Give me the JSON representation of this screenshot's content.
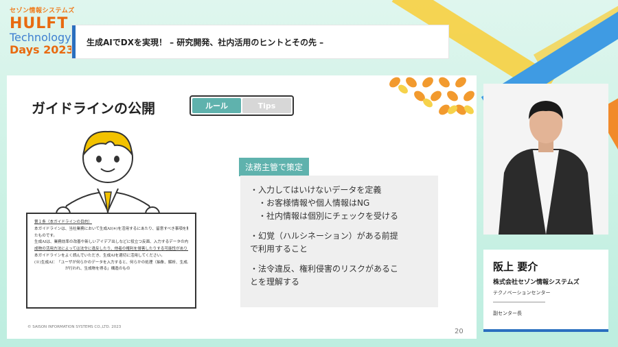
{
  "logo": {
    "brand": "セゾン情報システムズ",
    "line1": "HULFT",
    "line2": "Technology",
    "line3": "Days 2023"
  },
  "header": {
    "title": "生成AIでDXを実現！ – 研究開発、社内活用のヒントとその先 –"
  },
  "slide": {
    "title": "ガイドラインの公開",
    "toggle": {
      "active": "ルール",
      "inactive": "Tips"
    },
    "badge": "法務主管で策定",
    "points": {
      "p1": "・入力してはいけないデータを定義",
      "p1a": "・お客様情報や個人情報はNG",
      "p1b": "・社内情報は個別にチェックを受ける",
      "p2a": "・幻覚（ハルシネーション）がある前提",
      "p2b": "で利用すること",
      "p3a": "・法令違反、権利侵害のリスクがあるこ",
      "p3b": "とを理解する"
    },
    "doc": {
      "l1": "第１条（本ガイドラインの目的）",
      "l2": "本ガイドラインは、当社業務において生成AI(※)を活用するにあたり、留意すべき事項を解説し",
      "l3": "たものです。",
      "l4": "生成AIは、業務効率の改善や新しいアイデア出しなどに役立つ反面、入力するデータの内容や生",
      "l5": "成物の活用方法によっては法令に違反したり、他者の権利を侵害したりする可能性があります。",
      "l6": "本ガイドラインをよく読んでいただき、生成AIを適切に活用してください。",
      "l7": "(※)生成AI：　「ユーザが何らかのデータを入力すると、何らかの処理（抽象、解析、生成、学習、再構築等）",
      "l8": "　　　　　　　　が行われ、生成物を得る」構造のもの"
    },
    "copyright": "© SAISON INFORMATION SYSTEMS CO.,LTD. 2023",
    "page_number": "20"
  },
  "speaker": {
    "name": "阪上 要介",
    "company": "株式会社セゾン情報システムズ",
    "department": "テクノベーションセンター",
    "role": "副センター長"
  }
}
